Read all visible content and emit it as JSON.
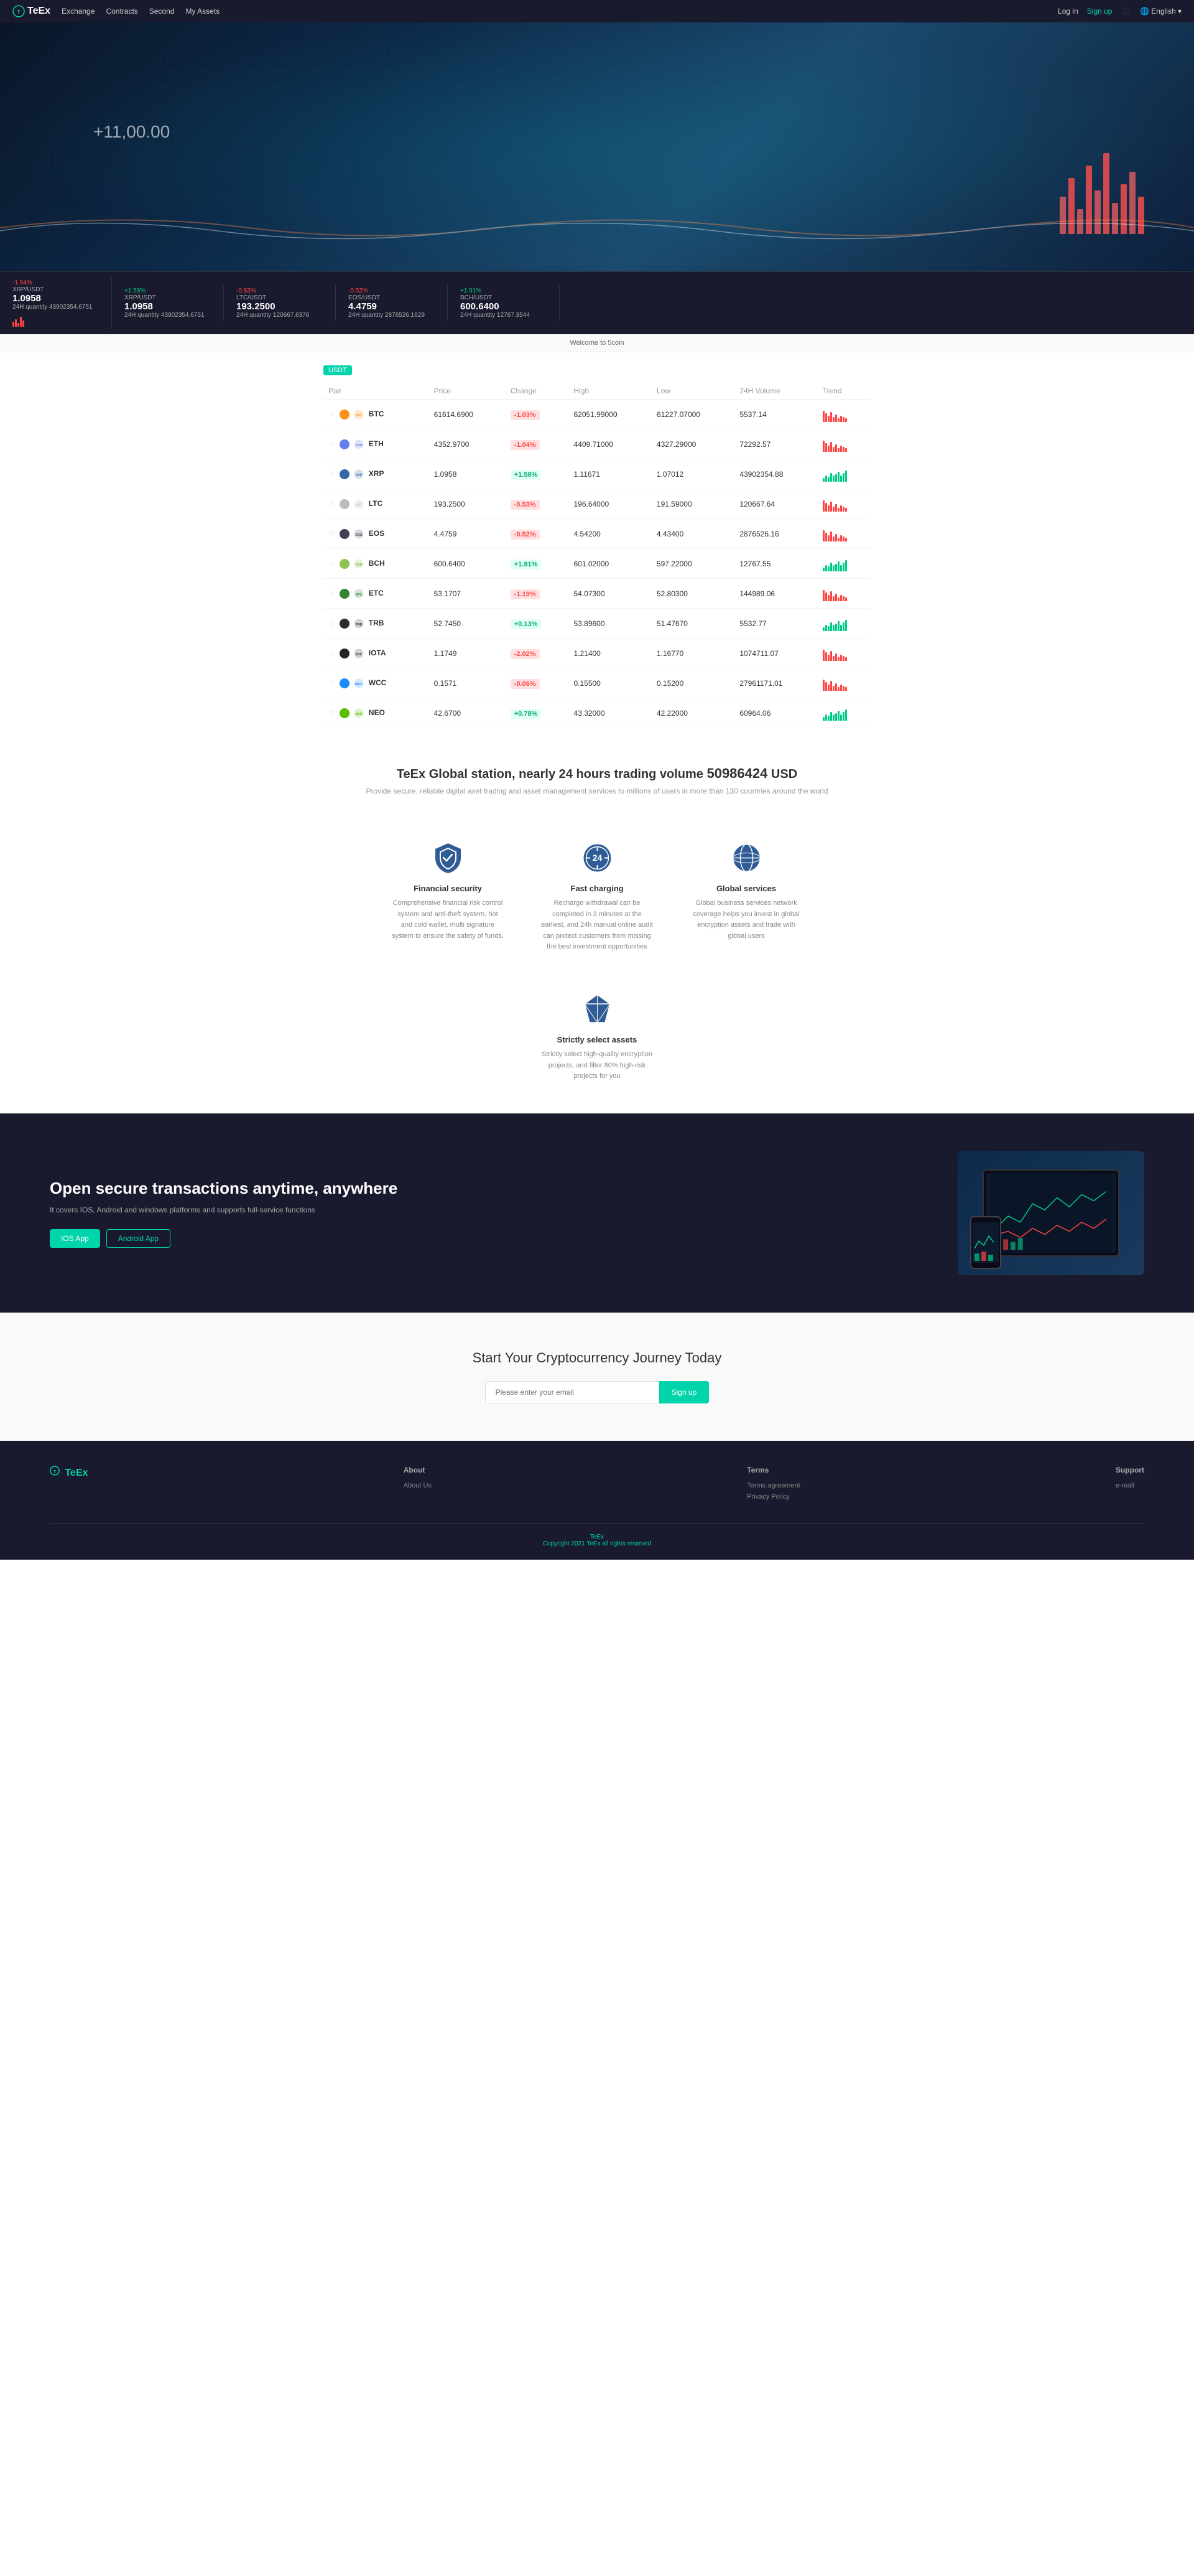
{
  "nav": {
    "logo": "TeEx",
    "links": [
      "Exchange",
      "Contracts",
      "Second",
      "My Assets"
    ],
    "login": "Log in",
    "signup": "Sign up",
    "lang": "English"
  },
  "ticker": [
    {
      "pair": "XRP/USDT",
      "change": "-1.94%",
      "changeType": "neg",
      "price": "1.0958",
      "vol": "24H quantity 43902354.6751"
    },
    {
      "pair": "XRP/USDT",
      "change": "+1.58%",
      "changeType": "pos",
      "price": "1.0958",
      "vol": "24H quantity 43902354.6751"
    },
    {
      "pair": "LTC/USDT",
      "change": "-0.83%",
      "changeType": "neg",
      "price": "193.2500",
      "vol": "24H quantity 120667.6376"
    },
    {
      "pair": "EOS/USDT",
      "change": "-0.52%",
      "changeType": "neg",
      "price": "4.4759",
      "vol": "24H quantity 2876526.1629"
    },
    {
      "pair": "BCH/USDT",
      "change": "+1.91%",
      "changeType": "pos",
      "price": "600.6400",
      "vol": "24H quantity 12767.3544"
    }
  ],
  "welcome": "Welcome to 5coin",
  "table": {
    "badge": "USDT",
    "headers": [
      "Pair",
      "Price",
      "Change",
      "High",
      "Low",
      "24H Volume",
      "Trend"
    ],
    "rows": [
      {
        "coin": "BTC",
        "colorClass": "btc-color",
        "price": "61614.6900",
        "change": "-1.03%",
        "changeType": "neg",
        "high": "62051.99000",
        "low": "61227.07000",
        "vol": "5537.14",
        "trend": "neg"
      },
      {
        "coin": "ETH",
        "colorClass": "eth-color",
        "price": "4352.9700",
        "change": "-1.04%",
        "changeType": "neg",
        "high": "4409.71000",
        "low": "4327.29000",
        "vol": "72292.57",
        "trend": "neg"
      },
      {
        "coin": "XRP",
        "colorClass": "xrp-color",
        "price": "1.0958",
        "change": "+1.58%",
        "changeType": "pos",
        "high": "1.11671",
        "low": "1.07012",
        "vol": "43902354.88",
        "trend": "pos"
      },
      {
        "coin": "LTC",
        "colorClass": "ltc-color",
        "price": "193.2500",
        "change": "-0.53%",
        "changeType": "neg",
        "high": "196.64000",
        "low": "191.59000",
        "vol": "120667.64",
        "trend": "neg"
      },
      {
        "coin": "EOS",
        "colorClass": "eos-color",
        "price": "4.4759",
        "change": "-0.52%",
        "changeType": "neg",
        "high": "4.54200",
        "low": "4.43400",
        "vol": "2876526.16",
        "trend": "neg"
      },
      {
        "coin": "BCH",
        "colorClass": "bch-color",
        "price": "600.6400",
        "change": "+1.91%",
        "changeType": "pos",
        "high": "601.02000",
        "low": "597.22000",
        "vol": "12767.55",
        "trend": "pos"
      },
      {
        "coin": "ETC",
        "colorClass": "etc-color",
        "price": "53.1707",
        "change": "-1.19%",
        "changeType": "neg",
        "high": "54.07300",
        "low": "52.80300",
        "vol": "144989.06",
        "trend": "neg"
      },
      {
        "coin": "TRB",
        "colorClass": "trb-color",
        "price": "52.7450",
        "change": "+0.13%",
        "changeType": "pos",
        "high": "53.89600",
        "low": "51.47670",
        "vol": "5532.77",
        "trend": "pos"
      },
      {
        "coin": "IOTA",
        "colorClass": "iota-color",
        "price": "1.1749",
        "change": "-2.02%",
        "changeType": "neg",
        "high": "1.21400",
        "low": "1.16770",
        "vol": "1074711.07",
        "trend": "neg"
      },
      {
        "coin": "WCC",
        "colorClass": "wcc-color",
        "price": "0.1571",
        "change": "-0.06%",
        "changeType": "neg",
        "high": "0.15500",
        "low": "0.15200",
        "vol": "27961171.01",
        "trend": "neg"
      },
      {
        "coin": "NEO",
        "colorClass": "neo-color",
        "price": "42.6700",
        "change": "+0.78%",
        "changeType": "pos",
        "high": "43.32000",
        "low": "42.22000",
        "vol": "60964.06",
        "trend": "pos"
      }
    ]
  },
  "stats": {
    "prefix": "TeEx Global station, nearly 24 hours trading volume",
    "volume": "50986424",
    "currency": "USD",
    "subtitle": "Provide secure, reliable digital axet trading and asset management services to millions of users in more than 130 countries around the world"
  },
  "features": [
    {
      "name": "financial-security",
      "title": "Financial security",
      "desc": "Comprehensive financial risk control system and anti-theft system, hot and cold wallet, multi signature system to ensure the safety of funds.",
      "icon": "shield"
    },
    {
      "name": "fast-charging",
      "title": "Fast charging",
      "desc": "Recharge withdrawal can be completed in 3 minutes at the earliest, and 24h manual online audit can protect customers from missing the best investment opportunities",
      "icon": "clock24"
    },
    {
      "name": "global-services",
      "title": "Global services",
      "desc": "Global business services network coverage helps you invest in global encryption assets and trade with global users",
      "icon": "globe"
    },
    {
      "name": "strictly-select",
      "title": "Strictly select assets",
      "desc": "Strictly select high-quality encryption projects, and filter 80% high-risk projects for you",
      "icon": "diamond"
    }
  ],
  "app_section": {
    "title": "Open secure transactions anytime, anywhere",
    "subtitle": "It covers IOS, Android and windows platforms and supports full-service functions",
    "btn_ios": "IOS App",
    "btn_android": "Android App"
  },
  "cta": {
    "title": "Start Your Cryptocurrency Journey Today",
    "placeholder": "Please enter your email",
    "button": "Sign up"
  },
  "footer": {
    "logo": "TeEx",
    "cols": [
      {
        "heading": "About",
        "links": [
          "About Us"
        ]
      },
      {
        "heading": "Terms",
        "links": [
          "Terms agreement",
          "Privacy Policy"
        ]
      },
      {
        "heading": "Support",
        "links": [
          "e-mail"
        ]
      }
    ],
    "copyright": "Copyright 2021 TeEx all rights reserved"
  }
}
